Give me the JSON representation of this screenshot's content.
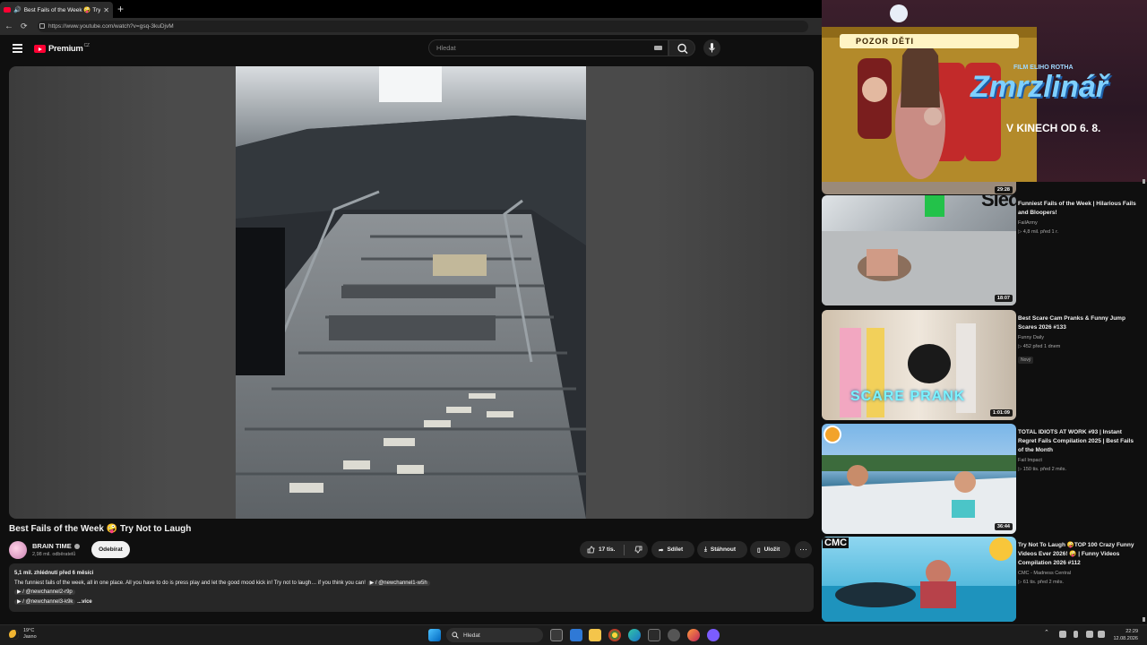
{
  "browser": {
    "tab_title": "Best Fails of the Week 🤪 Try",
    "new_tab": "+",
    "url": "https://www.youtube.com/watch?v=gsq-3kuDjvM"
  },
  "header": {
    "logo_text": "Premium",
    "logo_region": "CZ",
    "search_placeholder": "Hledat"
  },
  "video": {
    "title": "Best Fails of the Week 🤪 Try Not to Laugh",
    "channel": "BRAIN TIME",
    "subscribers": "2,98 mil. odběratelů",
    "subscribe_label": "Odebírat",
    "likes": "17 tis.",
    "share_label": "Sdílet",
    "download_label": "Stáhnout",
    "save_label": "Uložit",
    "description": {
      "meta": "5,1 mil. zhlédnutí  před 6 měsíci",
      "line1": "The funniest fails of the week, all in one place. All you have to do is press play and let the good mood kick in! Try not to laugh… if you think you can!",
      "link1": "/ @newchannel1-w5h",
      "link2": "/ @newchannel2-r9p",
      "link3": "/ @newchannel3-k9k",
      "more": "...více"
    }
  },
  "ad": {
    "sign": "POZOR DĚTI",
    "film": "FILM ELIHO ROTHA",
    "title": "Zmrzlinář",
    "release": "V KINECH OD 6. 8."
  },
  "recommendations": [
    {
      "title": "Funniest Fails of the Week | Hilarious Fails and Bloopers!",
      "channel": "FailArmy",
      "views": "4,8 mil.  před 1 r.",
      "duration": "18:07",
      "overlay": "Sledovat"
    },
    {
      "title": "Best Scare Cam Pranks & Funny Jump Scares 2026 #133",
      "channel": "Funny Daily",
      "views": "452  před 1 dnem",
      "badge": "Nový",
      "duration": "1:01:09",
      "thumb_text": "SCARE PRANK"
    },
    {
      "title": "TOTAL IDIOTS AT WORK #93 | Instant Regret Fails Compilation 2025 | Best Fails of the Month",
      "channel": "Fail Impact",
      "views": "150 tis.  před 2 měs.",
      "duration": "36:44"
    },
    {
      "title": "Try Not To Laugh 🤪TOP 100 Crazy Funny Videos Ever 2026! 🤪 | Funny Videos Compilation 2026 #112",
      "channel": "CMC - Madness Central",
      "views": "61 tis.  před 2 měs.",
      "thumb_text": "CMC"
    }
  ],
  "top_duration": "29:28",
  "taskbar": {
    "temp": "19°C",
    "weather": "Jasno",
    "search": "Hledat",
    "time": "22:29",
    "date": "12.08.2026"
  }
}
